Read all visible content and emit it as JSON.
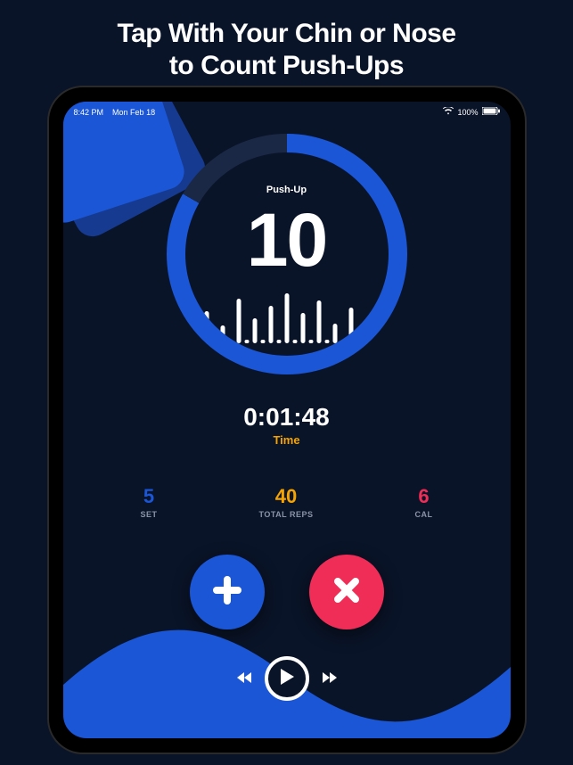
{
  "promo": {
    "line1": "Tap With Your Chin or Nose",
    "line2": "to Count Push-Ups"
  },
  "statusBar": {
    "time": "8:42 PM",
    "date": "Mon Feb 18",
    "battery": "100%"
  },
  "counter": {
    "exerciseLabel": "Push-Up",
    "repCount": "10"
  },
  "timer": {
    "value": "0:01:48",
    "label": "Time"
  },
  "stats": {
    "set": {
      "value": "5",
      "label": "SET"
    },
    "totalReps": {
      "value": "40",
      "label": "TOTAL REPS"
    },
    "cal": {
      "value": "6",
      "label": "CAL"
    }
  },
  "colors": {
    "accentBlue": "#1a56d6",
    "accentYellow": "#f5a300",
    "accentRed": "#ef2d56",
    "bgDark": "#0a1428"
  },
  "icons": {
    "plus": "plus-icon",
    "cancel": "close-icon",
    "play": "play-icon",
    "prev": "prev-icon",
    "next": "next-icon",
    "wifi": "wifi-icon",
    "battery": "battery-icon"
  }
}
